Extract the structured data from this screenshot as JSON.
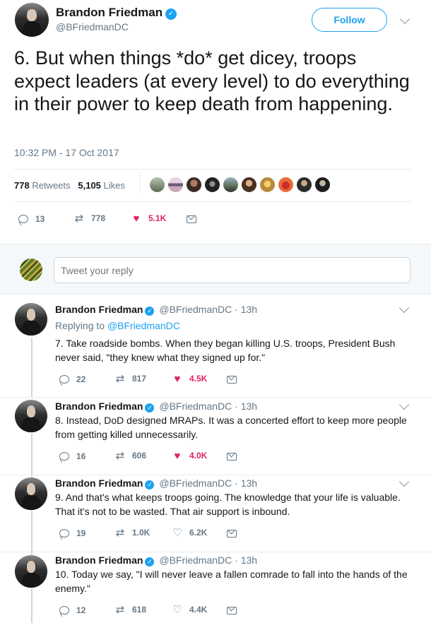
{
  "main_tweet": {
    "display_name": "Brandon Friedman",
    "handle": "@BFriedmanDC",
    "follow_label": "Follow",
    "text": "6. But when things *do* get dicey, troops expect leaders (at every level) to do everything in their power to keep death from happening.",
    "timestamp": "10:32 PM - 17 Oct 2017",
    "retweets_count": "778",
    "retweets_label": "Retweets",
    "likes_count": "5,105",
    "likes_label": "Likes",
    "actions": {
      "replies": "13",
      "retweets": "778",
      "likes": "5.1K"
    }
  },
  "reply_box": {
    "placeholder": "Tweet your reply"
  },
  "replies": [
    {
      "display_name": "Brandon Friedman",
      "handle": "@BFriedmanDC",
      "time": "· 13h",
      "replying_prefix": "Replying to",
      "replying_to": "@BFriedmanDC",
      "text": "7. Take roadside bombs. When they began killing U.S. troops, President Bush never said, \"they knew what they signed up for.\"",
      "actions": {
        "replies": "22",
        "retweets": "817",
        "likes": "4.5K",
        "liked": true
      }
    },
    {
      "display_name": "Brandon Friedman",
      "handle": "@BFriedmanDC",
      "time": "· 13h",
      "text": "8. Instead, DoD designed MRAPs. It was a concerted effort to keep more people from getting killed unnecessarily.",
      "actions": {
        "replies": "16",
        "retweets": "606",
        "likes": "4.0K",
        "liked": true
      }
    },
    {
      "display_name": "Brandon Friedman",
      "handle": "@BFriedmanDC",
      "time": "· 13h",
      "text": "9. And that's what keeps troops going. The knowledge that your life is valuable. That it's not to be wasted. That air support is inbound.",
      "actions": {
        "replies": "19",
        "retweets": "1.0K",
        "likes": "6.2K",
        "liked": false
      }
    },
    {
      "display_name": "Brandon Friedman",
      "handle": "@BFriedmanDC",
      "time": "· 13h",
      "text": "10. Today we say, \"I will never leave a fallen comrade to fall into the hands of the enemy.\"",
      "actions": {
        "replies": "12",
        "retweets": "618",
        "likes": "4.4K",
        "liked": false
      }
    }
  ],
  "colors": {
    "accent": "#1da1f2",
    "like": "#e0245e",
    "muted": "#657786",
    "text": "#14171a"
  }
}
